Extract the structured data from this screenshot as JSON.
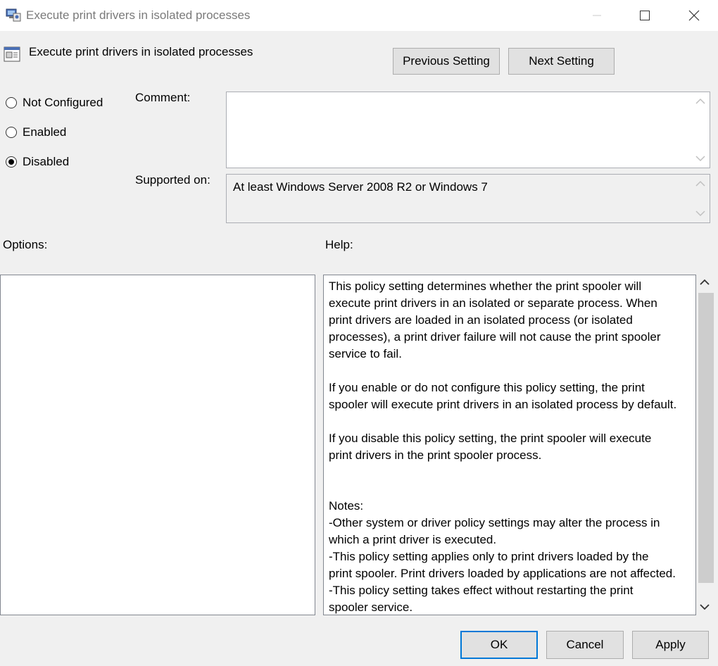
{
  "window": {
    "title": "Execute print drivers in isolated processes",
    "icon": "group-policy-icon",
    "controls": [
      "minimize-icon",
      "maximize-icon",
      "close-icon"
    ]
  },
  "header": {
    "policy_name": "Execute print drivers in isolated processes",
    "previous_label": "Previous Setting",
    "next_label": "Next Setting"
  },
  "state": {
    "options": [
      {
        "label": "Not Configured",
        "selected": false
      },
      {
        "label": "Enabled",
        "selected": false
      },
      {
        "label": "Disabled",
        "selected": true
      }
    ]
  },
  "comment": {
    "label": "Comment:",
    "value": ""
  },
  "supported": {
    "label": "Supported on:",
    "value": "At least Windows Server 2008 R2 or Windows 7"
  },
  "options_panel": {
    "label": "Options:"
  },
  "help": {
    "label": "Help:",
    "lines": [
      "This policy setting determines whether the print spooler will",
      "execute print drivers in an isolated or separate process. When",
      "print drivers are loaded in an isolated process (or isolated",
      "processes), a print driver failure will not cause the print spooler",
      "service to fail.",
      "If you enable or do not configure this policy setting, the print",
      "spooler will execute print drivers in an isolated process by default.",
      "If you disable this policy setting, the print spooler will execute",
      "print drivers in the print spooler process.",
      "Notes:",
      "-Other system or driver policy settings may alter the process in",
      "which a print driver is executed.",
      "-This policy setting applies only to print drivers loaded by the",
      "print spooler. Print drivers loaded by applications are not affected.",
      "-This policy setting takes effect without restarting the print",
      "spooler service."
    ]
  },
  "footer": {
    "ok_label": "OK",
    "cancel_label": "Cancel",
    "apply_label": "Apply"
  },
  "colors": {
    "focus": "#0078d7",
    "background": "#f0f0f0",
    "title_text": "#7a7a7a"
  }
}
